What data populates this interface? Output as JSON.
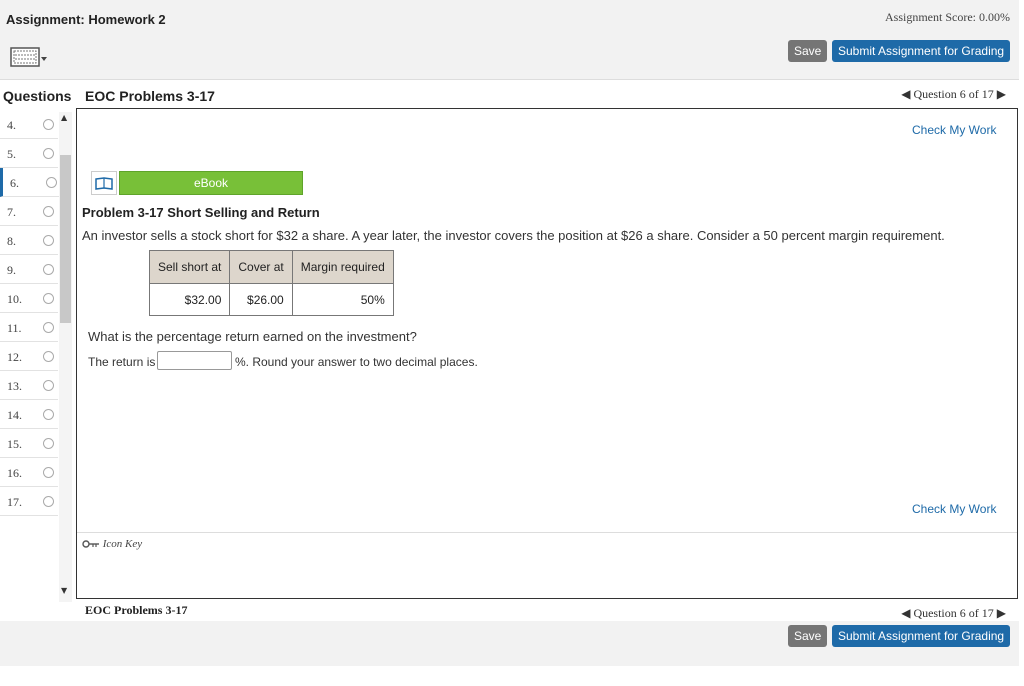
{
  "header": {
    "assignment_title": "Assignment: Homework 2",
    "score": "Assignment Score: 0.00%",
    "save_label": "Save",
    "submit_label": "Submit Assignment for Grading"
  },
  "sidebar": {
    "title": "Questions",
    "items": [
      {
        "label": "4."
      },
      {
        "label": "5."
      },
      {
        "label": "6."
      },
      {
        "label": "7."
      },
      {
        "label": "8."
      },
      {
        "label": "9."
      },
      {
        "label": "10."
      },
      {
        "label": "11."
      },
      {
        "label": "12."
      },
      {
        "label": "13."
      },
      {
        "label": "14."
      },
      {
        "label": "15."
      },
      {
        "label": "16."
      },
      {
        "label": "17."
      }
    ],
    "active_label": "6."
  },
  "section": {
    "title": "EOC Problems 3-17",
    "question_nav": "Question 6 of 17"
  },
  "main": {
    "check_label": "Check My Work",
    "ebook_label": "eBook",
    "problem_title": "Problem 3-17 Short Selling and Return",
    "problem_text": "An investor sells a stock short for $32 a share. A year later, the investor covers the position at $26 a share. Consider a 50 percent margin requirement.",
    "table": {
      "headers": [
        "Sell short at",
        "Cover at",
        "Margin required"
      ],
      "row": [
        "$32.00",
        "$26.00",
        "50%"
      ]
    },
    "question": "What is the percentage return earned on the investment?",
    "return_label": "The return is",
    "return_value": "",
    "return_suffix": "%. Round your answer to two decimal places.",
    "icon_key": "Icon Key"
  },
  "footer": {
    "section_title": "EOC Problems 3-17",
    "question_nav": "Question 6 of 17",
    "save_label": "Save",
    "submit_label": "Submit Assignment for Grading"
  },
  "colors": {
    "accent": "#1e6aa8",
    "ebook_green": "#78c038",
    "save_gray": "#757575"
  }
}
